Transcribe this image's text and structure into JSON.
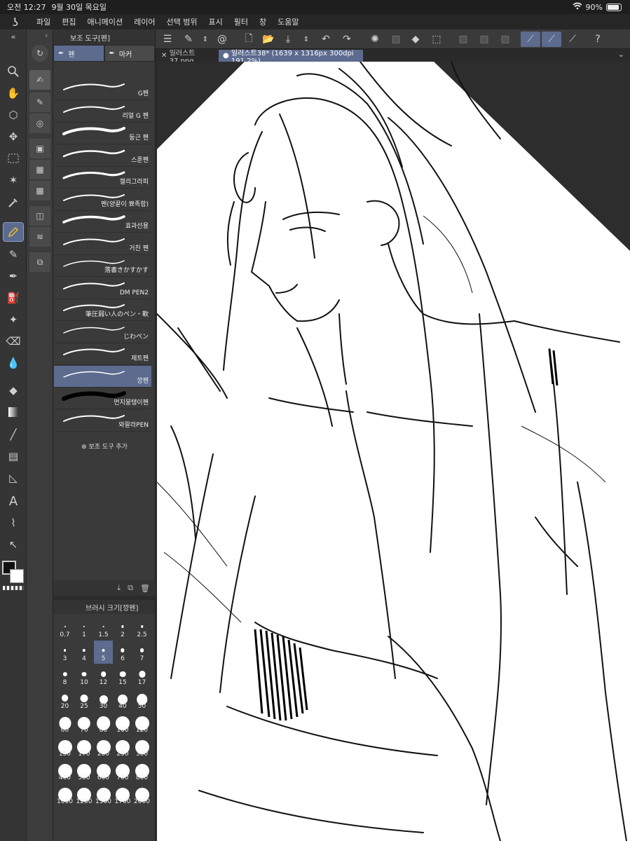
{
  "status": {
    "time": "오전 12:27",
    "date": "9월 30일 목요일",
    "battery": "90%",
    "battery_level": 0.9
  },
  "menu": [
    "파일",
    "편집",
    "애니메이션",
    "레이어",
    "선택 범위",
    "표시",
    "필터",
    "창",
    "도움말"
  ],
  "subtool": {
    "header": "보조 도구[펜]",
    "tabs": [
      "펜",
      "마커"
    ],
    "brushes": [
      "G펜",
      "리얼 G 펜",
      "둥근 펜",
      "스푼펜",
      "캘리그라피",
      "펜(양끝이 뾰족함)",
      "효과선용",
      "거친 펜",
      "落書きかすかす",
      "DM PEN2",
      "筆圧弱い人のペン・軟",
      "じわペン",
      "제트펜",
      "깡펜",
      "먼지뭉탱이펜",
      "와랄라PEN"
    ],
    "active_brush": "깡펜",
    "add_label": "보조 도구 추가"
  },
  "brush_size": {
    "header": "브러시 크기[깡펜]",
    "sizes": [
      "0.7",
      "1",
      "1.5",
      "2",
      "2.5",
      "3",
      "4",
      "5",
      "6",
      "7",
      "8",
      "10",
      "12",
      "15",
      "17",
      "20",
      "25",
      "30",
      "40",
      "50",
      "60",
      "70",
      "80",
      "100",
      "120",
      "150",
      "170",
      "200",
      "250",
      "300",
      "400",
      "500",
      "600",
      "700",
      "800",
      "1000",
      "1200",
      "1500",
      "1700",
      "2000"
    ],
    "active": "5"
  },
  "canvas_tabs": [
    {
      "label": "일러스트37.png"
    },
    {
      "label": "일러스트38* (1639 x 1316px 300dpi 191.2%)"
    }
  ],
  "colors": {
    "accent": "#5c6b8e",
    "main_color": "#111111",
    "sub_color": "#ffffff"
  }
}
